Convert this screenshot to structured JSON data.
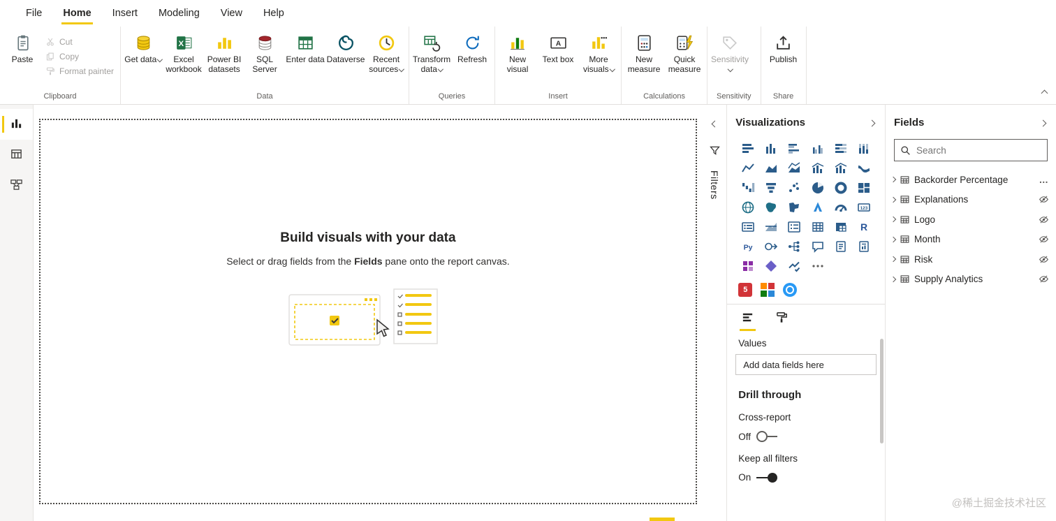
{
  "menu": {
    "items": [
      {
        "label": "File",
        "active": false
      },
      {
        "label": "Home",
        "active": true
      },
      {
        "label": "Insert",
        "active": false
      },
      {
        "label": "Modeling",
        "active": false
      },
      {
        "label": "View",
        "active": false
      },
      {
        "label": "Help",
        "active": false
      }
    ]
  },
  "ribbon": {
    "groups": [
      {
        "name": "Clipboard",
        "primary": {
          "label": "Paste",
          "icon": "paste",
          "disabled": false,
          "dropdown": false
        },
        "items": [
          {
            "label": "Cut",
            "icon": "cut",
            "disabled": true
          },
          {
            "label": "Copy",
            "icon": "copy",
            "disabled": true
          },
          {
            "label": "Format painter",
            "icon": "format-painter",
            "disabled": true
          }
        ]
      },
      {
        "name": "Data",
        "buttons": [
          {
            "label": "Get data",
            "icon": "get-data",
            "dropdown": true
          },
          {
            "label": "Excel workbook",
            "icon": "excel-workbook"
          },
          {
            "label": "Power BI datasets",
            "icon": "powerbi-datasets"
          },
          {
            "label": "SQL Server",
            "icon": "sql-server"
          },
          {
            "label": "Enter data",
            "icon": "enter-data"
          },
          {
            "label": "Dataverse",
            "icon": "dataverse"
          },
          {
            "label": "Recent sources",
            "icon": "recent-sources",
            "dropdown": true
          }
        ]
      },
      {
        "name": "Queries",
        "buttons": [
          {
            "label": "Transform data",
            "icon": "transform-data",
            "dropdown": true
          },
          {
            "label": "Refresh",
            "icon": "refresh"
          }
        ]
      },
      {
        "name": "Insert",
        "buttons": [
          {
            "label": "New visual",
            "icon": "new-visual"
          },
          {
            "label": "Text box",
            "icon": "text-box"
          },
          {
            "label": "More visuals",
            "icon": "more-visuals",
            "dropdown": true
          }
        ]
      },
      {
        "name": "Calculations",
        "buttons": [
          {
            "label": "New measure",
            "icon": "new-measure"
          },
          {
            "label": "Quick measure",
            "icon": "quick-measure"
          }
        ]
      },
      {
        "name": "Sensitivity",
        "buttons": [
          {
            "label": "Sensitivity",
            "icon": "sensitivity",
            "dropdown": true,
            "disabled": true
          }
        ]
      },
      {
        "name": "Share",
        "buttons": [
          {
            "label": "Publish",
            "icon": "publish"
          }
        ]
      }
    ]
  },
  "left_rail": {
    "items": [
      {
        "name": "report-view",
        "active": true
      },
      {
        "name": "data-view",
        "active": false
      },
      {
        "name": "model-view",
        "active": false
      }
    ]
  },
  "canvas": {
    "title": "Build visuals with your data",
    "subtitle_prefix": "Select or drag fields from the ",
    "subtitle_bold": "Fields",
    "subtitle_suffix": " pane onto the report canvas."
  },
  "filters": {
    "title": "Filters"
  },
  "visualizations": {
    "title": "Visualizations",
    "icons": [
      "stacked-bar-chart",
      "stacked-column-chart",
      "clustered-bar-chart",
      "clustered-column-chart",
      "hundred-percent-stacked-bar-chart",
      "hundred-percent-stacked-column-chart",
      "line-chart",
      "area-chart",
      "stacked-area-chart",
      "line-and-stacked-column-chart",
      "line-and-clustered-column-chart",
      "ribbon-chart",
      "waterfall-chart",
      "funnel-chart",
      "scatter-chart",
      "pie-chart",
      "donut-chart",
      "treemap",
      "map",
      "filled-map",
      "shape-map",
      "azure-map",
      "gauge",
      "card",
      "multi-row-card",
      "kpi",
      "slicer",
      "table",
      "matrix",
      "r-script-visual",
      "python-visual",
      "key-influencers",
      "decomposition-tree",
      "q-and-a",
      "smart-narrative",
      "paginated-report",
      "power-apps",
      "power-automate",
      "metrics",
      "more-options"
    ],
    "custom_icons": [
      {
        "name": "custom-visual-1",
        "shape": "square",
        "color": "#d13438",
        "glyph": "5"
      },
      {
        "name": "custom-visual-2",
        "shape": "grid",
        "color": "#ff8c00",
        "glyph": ""
      },
      {
        "name": "custom-visual-3",
        "shape": "circle",
        "color": "#2899f5",
        "glyph": ""
      }
    ],
    "tabs": [
      {
        "name": "build-visual-tab",
        "icon": "build-fields",
        "active": true
      },
      {
        "name": "format-tab",
        "icon": "format-roller",
        "active": false
      }
    ],
    "values_label": "Values",
    "field_well_placeholder": "Add data fields here",
    "drill_through_title": "Drill through",
    "cross_report_label": "Cross-report",
    "cross_report_state": "Off",
    "keep_filters_label": "Keep all filters",
    "keep_filters_state": "On"
  },
  "fields_pane": {
    "title": "Fields",
    "search_placeholder": "Search",
    "items": [
      {
        "label": "Backorder Percentage",
        "trailing": "more"
      },
      {
        "label": "Explanations",
        "trailing": "hidden"
      },
      {
        "label": "Logo",
        "trailing": "hidden"
      },
      {
        "label": "Month",
        "trailing": "hidden"
      },
      {
        "label": "Risk",
        "trailing": "hidden"
      },
      {
        "label": "Supply Analytics",
        "trailing": "hidden"
      }
    ]
  },
  "watermark": "@稀土掘金技术社区",
  "colors": {
    "accent": "#f2c811",
    "icon_blue": "#2b5c8a"
  }
}
